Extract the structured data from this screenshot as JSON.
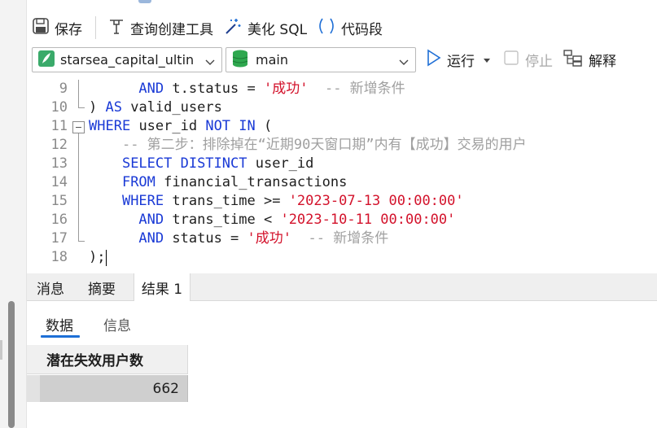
{
  "toolbar": {
    "save_label": "保存",
    "query_builder_label": "查询创建工具",
    "beautify_label": "美化 SQL",
    "snippet_label": "代码段"
  },
  "connection": {
    "database": "starsea_capital_ultin",
    "schema": "main"
  },
  "actions": {
    "run_label": "运行",
    "stop_label": "停止",
    "explain_label": "解释"
  },
  "editor": {
    "lines": [
      {
        "num": "9",
        "indent": "      ",
        "parts": [
          [
            "kw",
            "AND"
          ],
          [
            "",
            "t.status = "
          ],
          [
            "str",
            "'成功'"
          ],
          [
            "",
            "  "
          ],
          [
            "cm",
            "-- 新增条件"
          ]
        ]
      },
      {
        "num": "10",
        "indent": "",
        "parts": [
          [
            "",
            ") "
          ],
          [
            "kw",
            "AS"
          ],
          [
            "",
            "valid_users"
          ]
        ]
      },
      {
        "num": "11",
        "indent": "",
        "parts": [
          [
            "kw",
            "WHERE"
          ],
          [
            "",
            "user_id "
          ],
          [
            "kw",
            "NOT IN"
          ],
          [
            "",
            " ("
          ]
        ]
      },
      {
        "num": "12",
        "indent": "    ",
        "parts": [
          [
            "cm",
            "-- 第二步：排除掉在“近期90天窗口期”内有【成功】交易的用户"
          ]
        ]
      },
      {
        "num": "13",
        "indent": "    ",
        "parts": [
          [
            "kw",
            "SELECT DISTINCT"
          ],
          [
            "",
            "user_id"
          ]
        ]
      },
      {
        "num": "14",
        "indent": "    ",
        "parts": [
          [
            "kw",
            "FROM"
          ],
          [
            "",
            "financial_transactions"
          ]
        ]
      },
      {
        "num": "15",
        "indent": "    ",
        "parts": [
          [
            "kw",
            "WHERE"
          ],
          [
            "",
            "trans_time >= "
          ],
          [
            "str",
            "'2023-07-13 00:00:00'"
          ]
        ]
      },
      {
        "num": "16",
        "indent": "      ",
        "parts": [
          [
            "kw",
            "AND"
          ],
          [
            "",
            "trans_time < "
          ],
          [
            "str",
            "'2023-10-11 00:00:00'"
          ]
        ]
      },
      {
        "num": "17",
        "indent": "      ",
        "parts": [
          [
            "kw",
            "AND"
          ],
          [
            "",
            "status = "
          ],
          [
            "str",
            "'成功'"
          ],
          [
            "",
            "  "
          ],
          [
            "cm",
            "-- 新增条件"
          ]
        ]
      },
      {
        "num": "18",
        "indent": "",
        "parts": [
          [
            "",
            ");"
          ]
        ]
      }
    ]
  },
  "result_tabs": [
    "消息",
    "摘要",
    "结果 1"
  ],
  "sub_tabs": [
    "数据",
    "信息"
  ],
  "grid": {
    "column": "潜在失效用户数",
    "value": "662"
  },
  "colors": {
    "keyword": "#1a3ad6",
    "string": "#d3122b",
    "comment": "#a0a0a0",
    "accent": "#1d6fd6"
  },
  "icons": {
    "save": "floppy-disk-icon",
    "query_builder": "query-builder-icon",
    "beautify": "magic-wand-icon",
    "snippet": "parentheses-icon",
    "database": "feather-db-icon",
    "schema": "green-cylinder-icon",
    "run": "play-icon",
    "stop": "stop-checkbox-icon",
    "explain": "explain-tree-icon"
  }
}
